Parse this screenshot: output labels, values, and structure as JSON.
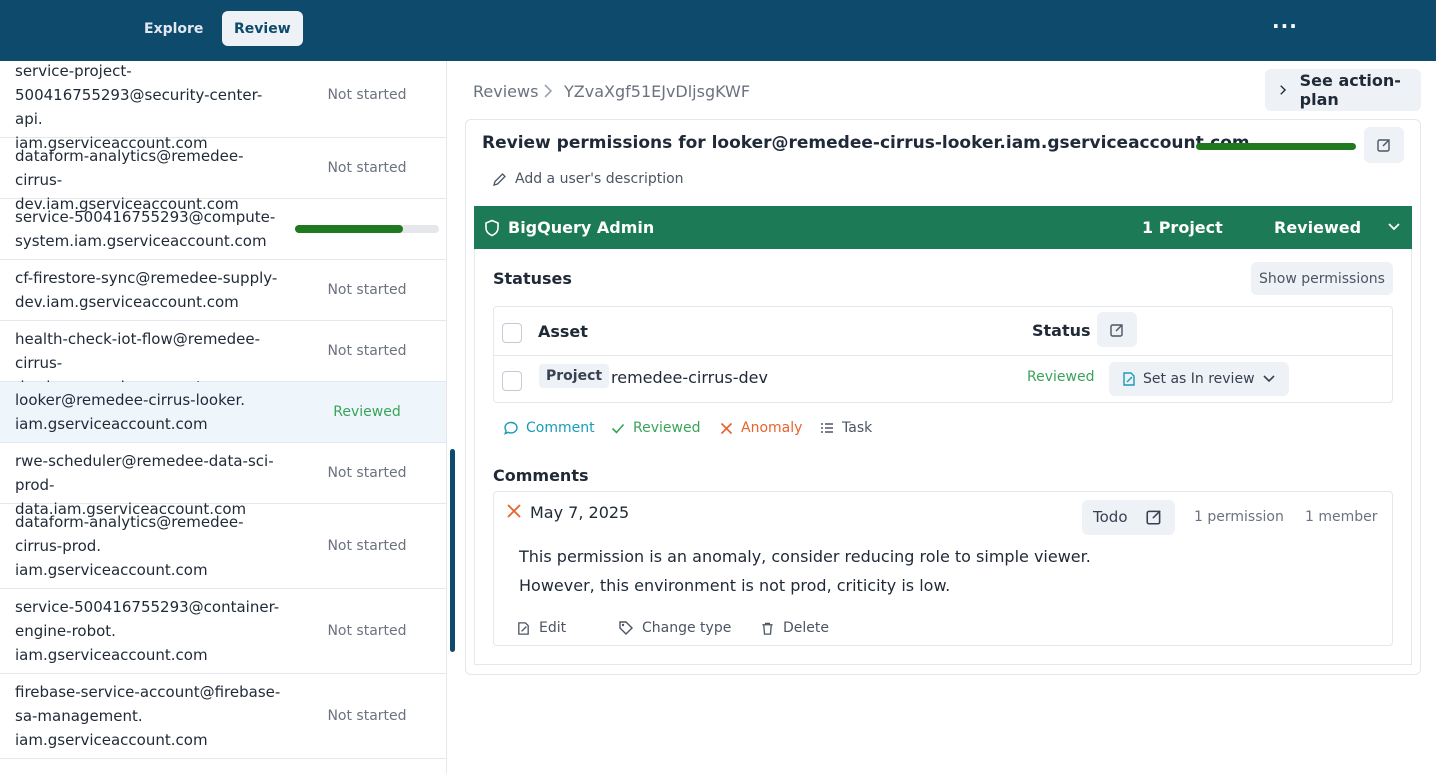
{
  "topbar": {
    "tabs": [
      {
        "label": "Explore",
        "active": false
      },
      {
        "label": "Review",
        "active": true
      }
    ],
    "more_label": "···"
  },
  "sidebar": {
    "items": [
      {
        "name": "service-project-\n500416755293@security-center-api.\niam.gserviceaccount.com",
        "status": "Not started"
      },
      {
        "name": "dataform-analytics@remedee-\ncirrus-dev.iam.gserviceaccount.com",
        "status": "Not started"
      },
      {
        "name": "service-500416755293@compute-\nsystem.iam.gserviceaccount.com",
        "status": "",
        "progress": 0.75
      },
      {
        "name": "cf-firestore-sync@remedee-supply-\ndev.iam.gserviceaccount.com",
        "status": "Not started"
      },
      {
        "name": "health-check-iot-flow@remedee-\ncirrus-dev.iam.gserviceaccount.com",
        "status": "Not started"
      },
      {
        "name": "looker@remedee-cirrus-looker.\niam.gserviceaccount.com",
        "status": "Reviewed"
      },
      {
        "name": "rwe-scheduler@remedee-data-sci-\nprod-data.iam.gserviceaccount.com",
        "status": "Not started"
      },
      {
        "name": "dataform-analytics@remedee-\ncirrus-prod.\niam.gserviceaccount.com",
        "status": "Not started"
      },
      {
        "name": "service-500416755293@container-\nengine-robot.\niam.gserviceaccount.com",
        "status": "Not started"
      },
      {
        "name": "firebase-service-account@firebase-\nsa-management.\niam.gserviceaccount.com",
        "status": "Not started"
      }
    ]
  },
  "breadcrumb": {
    "root": "Reviews",
    "id": "YZvaXgf51EJvDljsgKWF"
  },
  "action_plan_label": "See action-plan",
  "review": {
    "title": "Review permissions for looker@remedee-cirrus-looker.iam.gserviceaccount.com",
    "progress": 1.0,
    "description_placeholder": "Add a user's description",
    "role": {
      "name": "BigQuery Admin",
      "projects": "1 Project",
      "status": "Reviewed"
    },
    "statuses_heading": "Statuses",
    "show_permissions_label": "Show permissions",
    "table": {
      "col_asset": "Asset",
      "col_status": "Status",
      "rows": [
        {
          "type": "Project",
          "asset": "remedee-cirrus-dev",
          "status": "Reviewed",
          "action": "Set as In review"
        }
      ]
    },
    "actions": {
      "comment": "Comment",
      "reviewed": "Reviewed",
      "anomaly": "Anomaly",
      "task": "Task"
    },
    "comments_heading": "Comments",
    "comment": {
      "date": "May 7, 2025",
      "todo": "Todo",
      "permissions": "1 permission",
      "members": "1 member",
      "line1": "This permission is an anomaly, consider reducing role to simple viewer.",
      "line2": "However, this environment is not prod, criticity is low.",
      "edit": "Edit",
      "change_type": "Change type",
      "delete": "Delete"
    }
  },
  "colors": {
    "topbar": "#0e4a6c",
    "role_bar": "#1c7a56",
    "progress": "#1f7a1f",
    "reviewed": "#3aa35a",
    "comment": "#1a9bb8",
    "anomaly": "#e8632b"
  }
}
